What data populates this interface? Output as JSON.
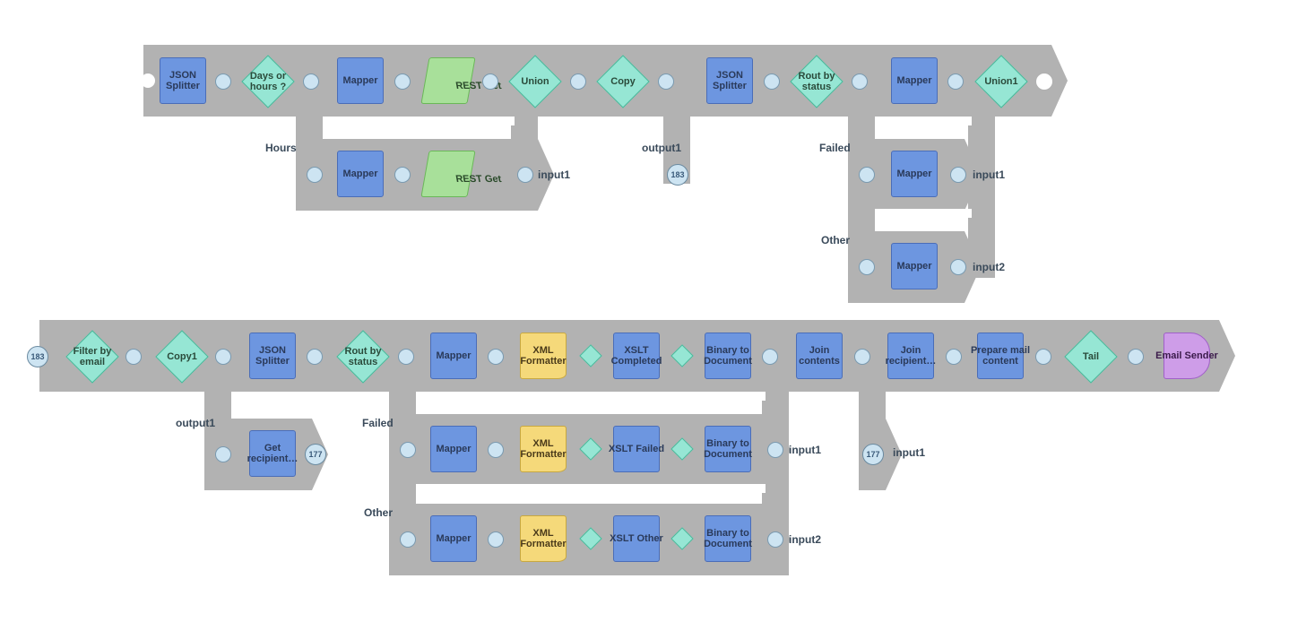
{
  "colors": {
    "bar": "#b2b2b2",
    "blue": "#6d96e0",
    "teal": "#96e6d4",
    "green": "#a8e09a",
    "yellow": "#f5d97a",
    "purple": "#ce9de8"
  },
  "top_row": {
    "main": [
      {
        "id": "json_split_1",
        "type": "square",
        "color": "blue",
        "label": "JSON Splitter"
      },
      {
        "id": "days_hours",
        "type": "diamond",
        "color": "teal",
        "label": "Days or hours ?"
      },
      {
        "id": "mapper_t1",
        "type": "square",
        "color": "blue",
        "label": "Mapper"
      },
      {
        "id": "rest_get_t1",
        "type": "skew",
        "color": "green",
        "label": "REST Get"
      },
      {
        "id": "union_t",
        "type": "diamond",
        "color": "teal",
        "label": "Union"
      },
      {
        "id": "copy_t",
        "type": "diamond",
        "color": "teal",
        "label": "Copy"
      },
      {
        "id": "json_split_2",
        "type": "square",
        "color": "blue",
        "label": "JSON Splitter"
      },
      {
        "id": "rout_status_t",
        "type": "diamond",
        "color": "teal",
        "label": "Rout by status"
      },
      {
        "id": "mapper_t2",
        "type": "square",
        "color": "blue",
        "label": "Mapper"
      },
      {
        "id": "union1",
        "type": "diamond",
        "color": "teal",
        "label": "Union1"
      }
    ],
    "branch_hours": {
      "label": "Hours",
      "nodes": [
        {
          "id": "mapper_h",
          "type": "square",
          "color": "blue",
          "label": "Mapper"
        },
        {
          "id": "rest_get_h",
          "type": "skew",
          "color": "green",
          "label": "REST Get"
        }
      ],
      "out_label": "input1"
    },
    "branch_copy": {
      "label": "output1",
      "out_port_id": "183"
    },
    "branch_rout_failed": {
      "label": "Failed",
      "nodes": [
        {
          "id": "mapper_fail_t",
          "type": "square",
          "color": "blue",
          "label": "Mapper"
        }
      ],
      "out_label": "input1"
    },
    "branch_rout_other": {
      "label": "Other",
      "nodes": [
        {
          "id": "mapper_other_t",
          "type": "square",
          "color": "blue",
          "label": "Mapper"
        }
      ],
      "out_label": "input2"
    }
  },
  "bottom_row": {
    "in_port_id": "183",
    "main": [
      {
        "id": "filter_email",
        "type": "diamond",
        "color": "teal",
        "label": "Filter by email"
      },
      {
        "id": "copy1",
        "type": "diamond",
        "color": "teal",
        "label": "Copy1"
      },
      {
        "id": "json_split_b",
        "type": "square",
        "color": "blue",
        "label": "JSON Splitter"
      },
      {
        "id": "rout_status_b",
        "type": "diamond",
        "color": "teal",
        "label": "Rout by status"
      },
      {
        "id": "mapper_b1",
        "type": "square",
        "color": "blue",
        "label": "Mapper"
      },
      {
        "id": "xml_fmt_1",
        "type": "doc",
        "color": "yellow",
        "label": "XML Formatter"
      },
      {
        "id": "small_d1",
        "type": "small-diamond",
        "color": "teal",
        "label": ""
      },
      {
        "id": "xslt_comp",
        "type": "square",
        "color": "blue",
        "label": "XSLT Completed"
      },
      {
        "id": "small_d2",
        "type": "small-diamond",
        "color": "teal",
        "label": ""
      },
      {
        "id": "bin_doc_1",
        "type": "square",
        "color": "blue",
        "label": "Binary to Document"
      },
      {
        "id": "join_cont",
        "type": "square",
        "color": "blue",
        "label": "Join contents"
      },
      {
        "id": "join_recip",
        "type": "square",
        "color": "blue",
        "label": "Join recipient…"
      },
      {
        "id": "prep_mail",
        "type": "square",
        "color": "blue",
        "label": "Prepare mail content"
      },
      {
        "id": "tail",
        "type": "diamond",
        "color": "teal",
        "label": "Tail"
      },
      {
        "id": "email_send",
        "type": "cap",
        "color": "purple",
        "label": "Email Sender"
      }
    ],
    "branch_copy1": {
      "label": "output1",
      "nodes": [
        {
          "id": "get_recip",
          "type": "square",
          "color": "blue",
          "label": "Get recipient…"
        }
      ],
      "out_port_id": "177"
    },
    "branch_failed": {
      "label": "Failed",
      "nodes": [
        {
          "id": "mapper_f_b",
          "type": "square",
          "color": "blue",
          "label": "Mapper"
        },
        {
          "id": "xml_fmt_f",
          "type": "doc",
          "color": "yellow",
          "label": "XML Formatter"
        },
        {
          "id": "small_df1",
          "type": "small-diamond",
          "color": "teal",
          "label": ""
        },
        {
          "id": "xslt_fail",
          "type": "square",
          "color": "blue",
          "label": "XSLT Failed"
        },
        {
          "id": "small_df2",
          "type": "small-diamond",
          "color": "teal",
          "label": ""
        },
        {
          "id": "bin_doc_f",
          "type": "square",
          "color": "blue",
          "label": "Binary to Document"
        }
      ],
      "out_label": "input1"
    },
    "branch_other": {
      "label": "Other",
      "nodes": [
        {
          "id": "mapper_o_b",
          "type": "square",
          "color": "blue",
          "label": "Mapper"
        },
        {
          "id": "xml_fmt_o",
          "type": "doc",
          "color": "yellow",
          "label": "XML Formatter"
        },
        {
          "id": "small_do1",
          "type": "small-diamond",
          "color": "teal",
          "label": ""
        },
        {
          "id": "xslt_other",
          "type": "square",
          "color": "blue",
          "label": "XSLT Other"
        },
        {
          "id": "small_do2",
          "type": "small-diamond",
          "color": "teal",
          "label": ""
        },
        {
          "id": "bin_doc_o",
          "type": "square",
          "color": "blue",
          "label": "Binary to Document"
        }
      ],
      "out_label": "input2"
    },
    "branch_join_recip": {
      "in_port_id": "177",
      "out_label": "input1"
    }
  }
}
